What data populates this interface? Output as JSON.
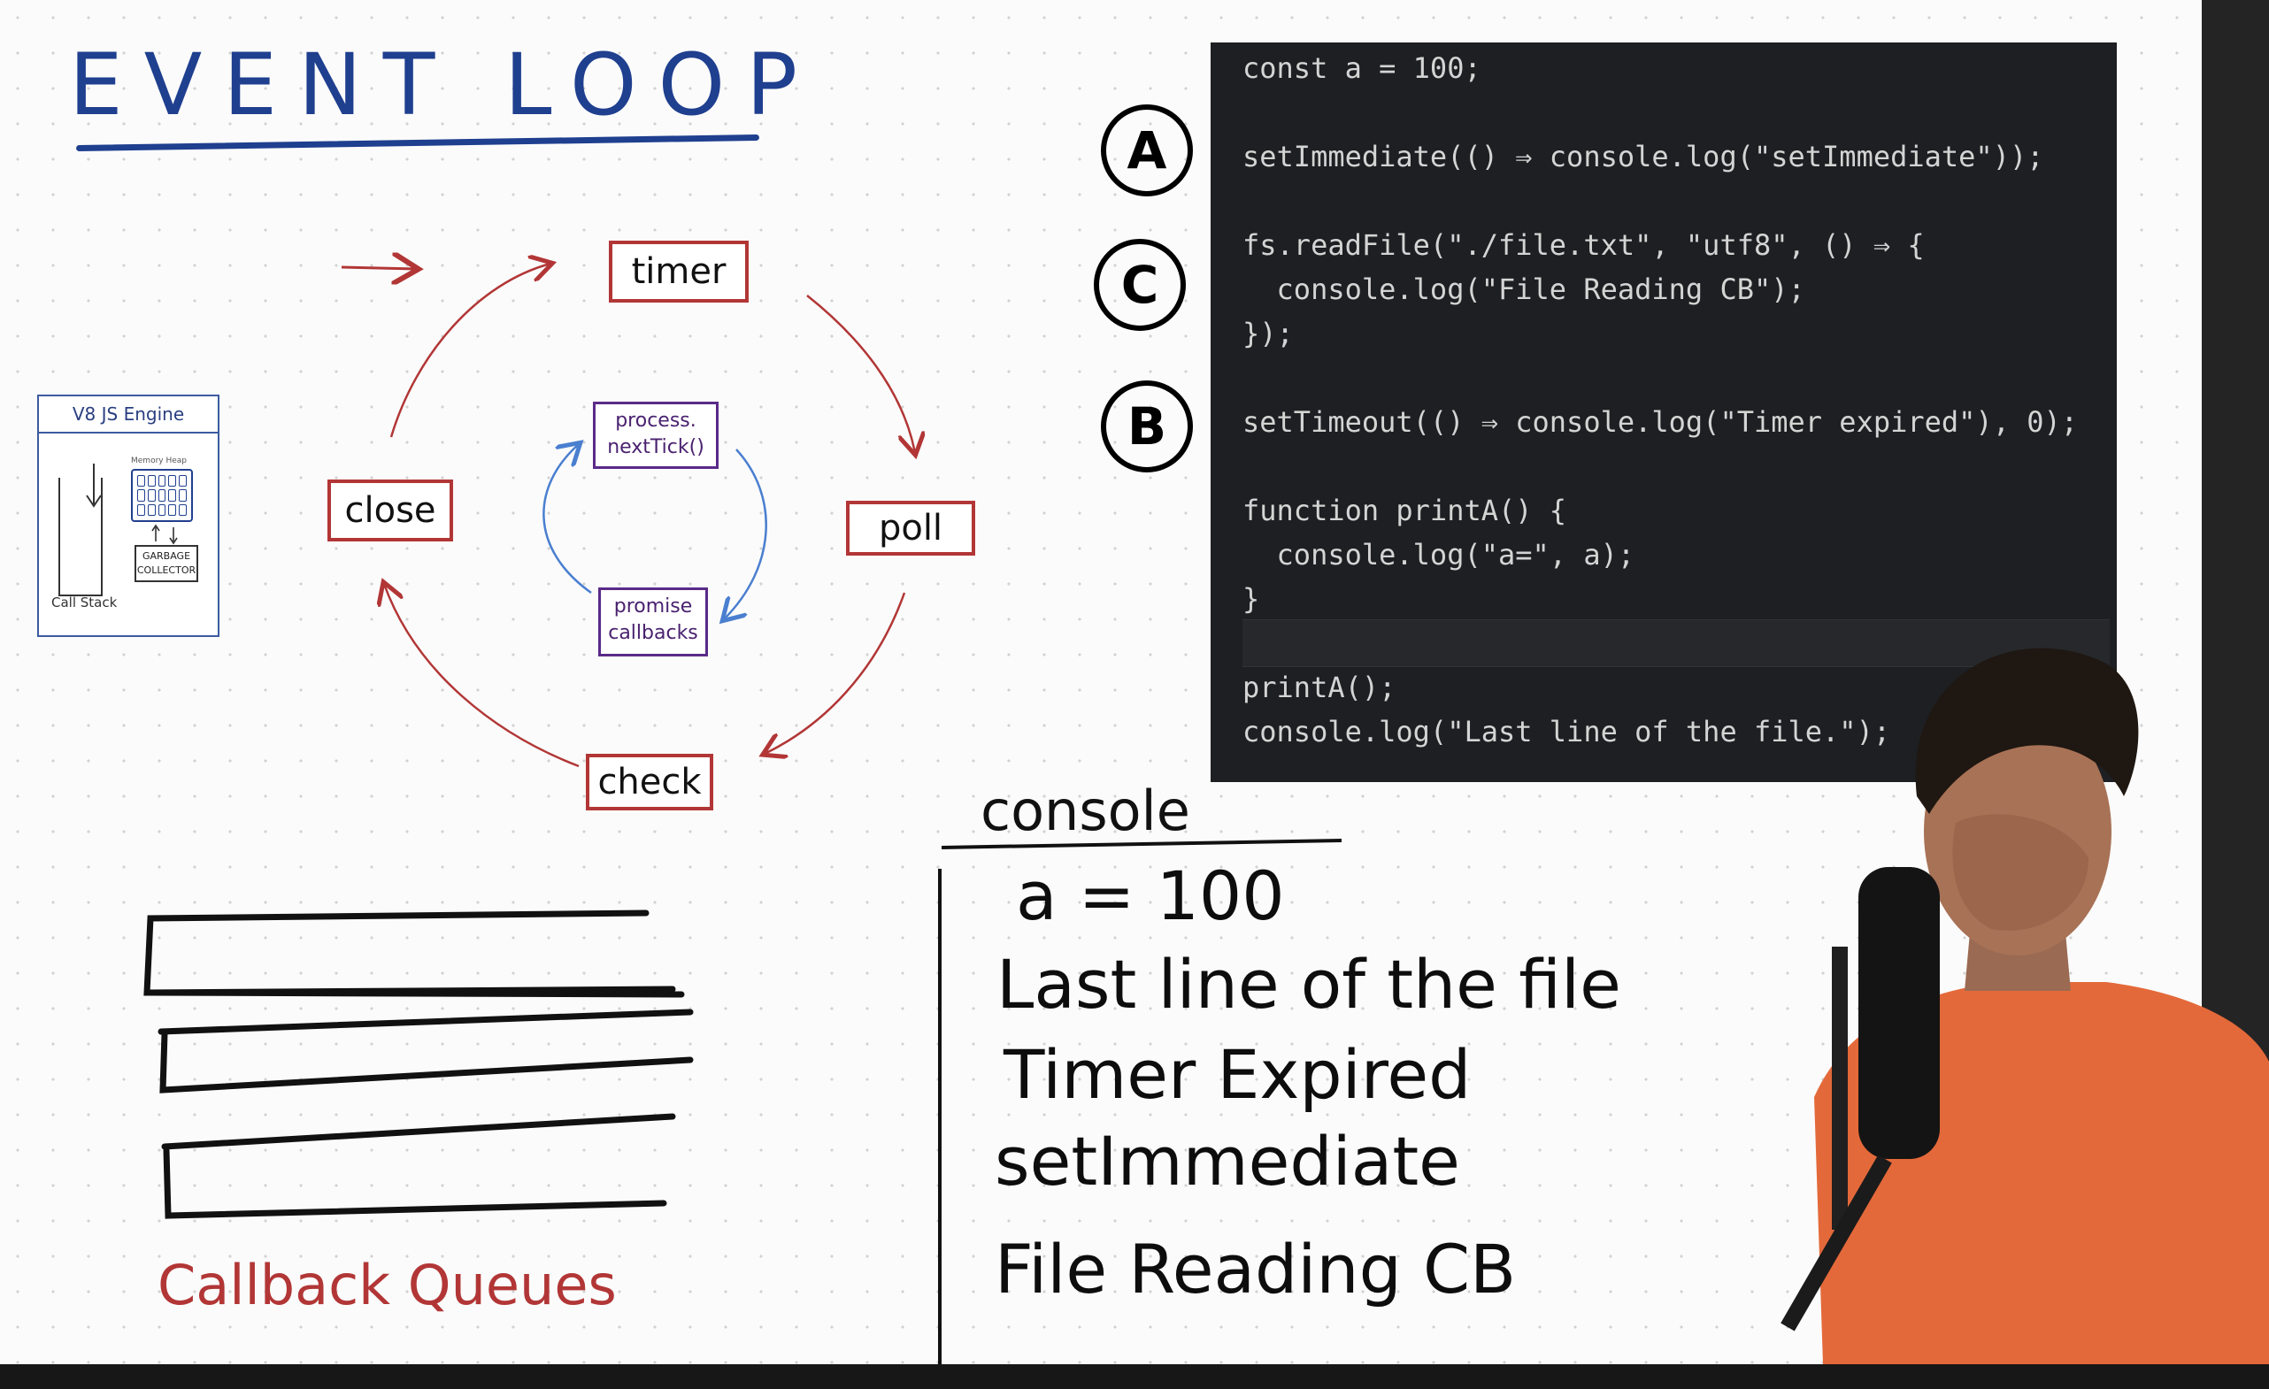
{
  "title": "EVENT LOOP",
  "phases": {
    "timer": "timer",
    "poll": "poll",
    "check": "check",
    "close": "close"
  },
  "microtasks": {
    "next_tick_line1": "process.",
    "next_tick_line2": "nextTick()",
    "promise_line1": "promise",
    "promise_line2": "callbacks"
  },
  "v8": {
    "title": "V8 JS Engine",
    "memory_heap": "Memory Heap",
    "gc_line1": "GARBAGE",
    "gc_line2": "COLLECTOR",
    "call_stack": "Call Stack"
  },
  "callback_queues": {
    "label": "Callback Queues"
  },
  "labels": {
    "a": "A",
    "c": "C",
    "b": "B"
  },
  "code": {
    "lines": [
      "const a = 100;",
      "setImmediate(() ⇒ console.log(\"setImmediate\"));",
      "fs.readFile(\"./file.txt\", \"utf8\", () ⇒ {",
      "  console.log(\"File Reading CB\");",
      "});",
      "setTimeout(() ⇒ console.log(\"Timer expired\"), 0);",
      "function printA() {",
      "  console.log(\"a=\", a);",
      "}",
      "printA();",
      "console.log(\"Last line of the file.\");"
    ]
  },
  "console": {
    "title": "console",
    "outputs": [
      "a = 100",
      "Last line of the file",
      "Timer Expired",
      "setImmediate",
      "File Reading CB"
    ]
  },
  "colors": {
    "title_blue": "#1f3f8f",
    "phase_red": "#b23636",
    "micro_purple": "#5a2a88",
    "editor_bg": "#1e1f22"
  }
}
